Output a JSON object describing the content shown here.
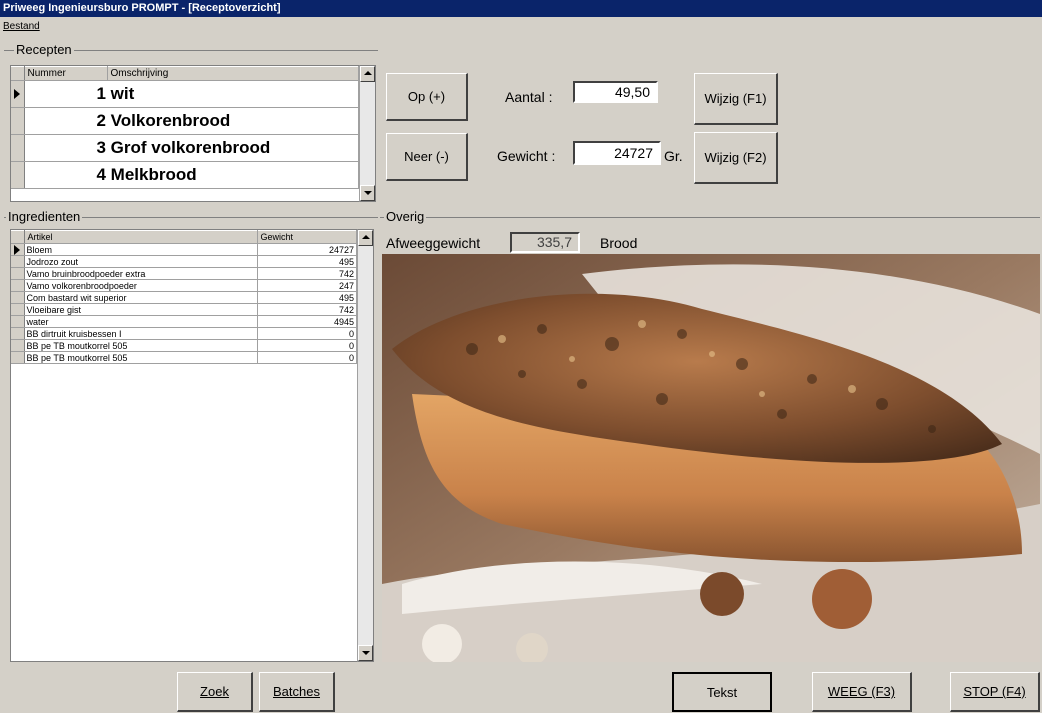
{
  "window": {
    "title": "Priweeg Ingenieursburo PROMPT - [Receptoverzicht]"
  },
  "menu": {
    "items": [
      {
        "label": "Bestand"
      }
    ]
  },
  "recepten": {
    "group_label": "Recepten",
    "columns": [
      "Nummer",
      "Omschrijving"
    ],
    "rows": [
      {
        "label": "1 wit",
        "selected": true
      },
      {
        "label": "2 Volkorenbrood",
        "selected": false
      },
      {
        "label": "3 Grof volkorenbrood",
        "selected": false
      },
      {
        "label": "4 Melkbrood",
        "selected": false
      }
    ]
  },
  "controls": {
    "op_label": "Op (+)",
    "neer_label": "Neer (-)",
    "aantal_label": "Aantal :",
    "aantal_value": "49,50",
    "gewicht_label": "Gewicht :",
    "gewicht_value": "24727",
    "gewicht_unit": "Gr.",
    "wijzig1_label": "Wijzig (F1)",
    "wijzig2_label": "Wijzig (F2)"
  },
  "ingredienten": {
    "group_label": "Ingredienten",
    "columns": [
      "Artikel",
      "Gewicht"
    ],
    "rows": [
      {
        "artikel": "Bloem",
        "gewicht": "24727",
        "selected": true
      },
      {
        "artikel": "Jodrozo zout",
        "gewicht": "495",
        "selected": false
      },
      {
        "artikel": "Vamo bruinbroodpoeder extra",
        "gewicht": "742",
        "selected": false
      },
      {
        "artikel": "Vamo volkorenbroodpoeder",
        "gewicht": "247",
        "selected": false
      },
      {
        "artikel": "Com bastard wit superior",
        "gewicht": "495",
        "selected": false
      },
      {
        "artikel": "Vloeibare gist",
        "gewicht": "742",
        "selected": false
      },
      {
        "artikel": "water",
        "gewicht": "4945",
        "selected": false
      },
      {
        "artikel": "BB dirtruit kruisbessen I",
        "gewicht": "0",
        "selected": false
      },
      {
        "artikel": "BB pe TB moutkorrel 505",
        "gewicht": "0",
        "selected": false
      },
      {
        "artikel": "BB pe TB moutkorrel 505",
        "gewicht": "0",
        "selected": false
      }
    ]
  },
  "overig": {
    "group_label": "Overig",
    "afweeggewicht_label": "Afweeggewicht",
    "afweeggewicht_value": "335,7",
    "type_label": "Brood"
  },
  "footer": {
    "zoek_label": "Zoek",
    "batches_label": "Batches",
    "tekst_label": "Tekst",
    "weeg_label": "WEEG (F3)",
    "stop_label": "STOP (F4)"
  },
  "colors": {
    "titlebar": "#0a246a",
    "face": "#d4d0c8",
    "selection_text": "#000000"
  }
}
